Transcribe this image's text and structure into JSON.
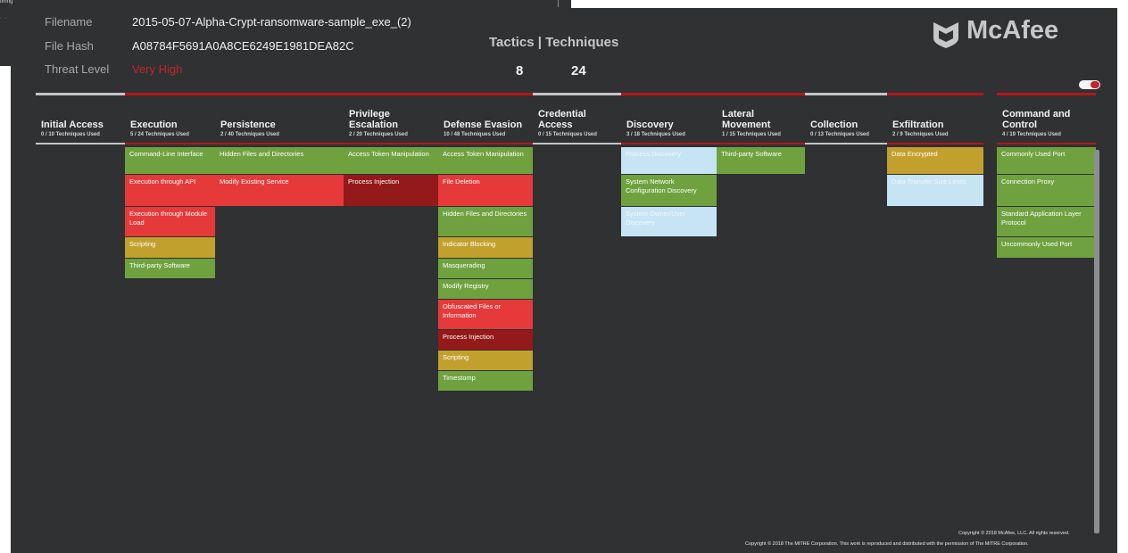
{
  "background": {
    "fragment_text": "oisoning",
    "fragment_dots": "· · ·"
  },
  "file_info": {
    "filename_label": "Filename",
    "filename_value": "2015-05-07-Alpha-Crypt-ransomware-sample_exe_(2)",
    "hash_label": "File Hash",
    "hash_value": "A08784F5691A0A8CE6249E1981DEA82C",
    "threat_label": "Threat Level",
    "threat_value": "Very High"
  },
  "summary": {
    "title": "Tactics | Techniques",
    "tactics_count": "8",
    "techniques_count": "24"
  },
  "logo": {
    "text": "McAfee",
    "icon": "mcafee-shield-icon"
  },
  "toggle": {
    "state": "on"
  },
  "colors": {
    "green": "#6fa23f",
    "red": "#e5393a",
    "dark_red": "#93191a",
    "yellow": "#c2a02d",
    "light_blue": "#c6e4f4",
    "used_bar": "#b3171b",
    "unused_bar": "#c4c5c7",
    "panel_bg": "#303133"
  },
  "tactics": [
    {
      "name": "Initial Access",
      "used": "0 / 10 Techniques Used",
      "active": false,
      "cells": []
    },
    {
      "name": "Execution",
      "used": "5 / 24 Techniques Used",
      "active": true,
      "cells": [
        {
          "label": "Command-Line Interface",
          "color": "green"
        },
        {
          "label": "Execution through API",
          "color": "red"
        },
        {
          "label": "Execution through Module Load",
          "color": "red"
        },
        {
          "label": "Scripting",
          "color": "yellow"
        },
        {
          "label": "Third-party Software",
          "color": "green"
        }
      ]
    },
    {
      "name": "Persistence",
      "used": "2 / 40 Techniques Used",
      "active": true,
      "cells": [
        {
          "label": "Hidden Files and Directories",
          "color": "green"
        },
        {
          "label": "Modify Existing Service",
          "color": "red"
        }
      ]
    },
    {
      "name": "Privilege Escalation",
      "used": "2 / 20 Techniques Used",
      "active": true,
      "cells": [
        {
          "label": "Access Token Manipulation",
          "color": "green"
        },
        {
          "label": "Process Injection",
          "color": "darkred"
        }
      ]
    },
    {
      "name": "Defense Evasion",
      "used": "10 / 48 Techniques Used",
      "active": true,
      "cells": [
        {
          "label": "Access Token Manipulation",
          "color": "green"
        },
        {
          "label": "File Deletion",
          "color": "red"
        },
        {
          "label": "Hidden Files and Directories",
          "color": "green"
        },
        {
          "label": "Indicator Blocking",
          "color": "yellow"
        },
        {
          "label": "Masquerading",
          "color": "green"
        },
        {
          "label": "Modify Registry",
          "color": "green"
        },
        {
          "label": "Obfuscated Files or Information",
          "color": "red"
        },
        {
          "label": "Process Injection",
          "color": "darkred"
        },
        {
          "label": "Scripting",
          "color": "yellow"
        },
        {
          "label": "Timestomp",
          "color": "green"
        }
      ]
    },
    {
      "name": "Credential Access",
      "used": "0 / 15 Techniques Used",
      "active": false,
      "cells": []
    },
    {
      "name": "Discovery",
      "used": "3 / 18 Techniques Used",
      "active": true,
      "cells": [
        {
          "label": "Process Discovery",
          "color": "lightblue"
        },
        {
          "label": "System Network Configuration Discovery",
          "color": "green"
        },
        {
          "label": "System Owner/User Discovery",
          "color": "lightblue"
        }
      ]
    },
    {
      "name": "Lateral Movement",
      "used": "1 / 15 Techniques Used",
      "active": true,
      "cells": [
        {
          "label": "Third-party Software",
          "color": "green"
        }
      ]
    },
    {
      "name": "Collection",
      "used": "0 / 13 Techniques Used",
      "active": false,
      "cells": []
    },
    {
      "name": "Exfiltration",
      "used": "2 / 9 Techniques Used",
      "active": true,
      "cells": [
        {
          "label": "Data Encrypted",
          "color": "yellow"
        },
        {
          "label": "Data Transfer Size Limits",
          "color": "lightblue"
        }
      ]
    },
    {
      "name": "Command and Control",
      "used": "4 / 19 Techniques Used",
      "active": true,
      "cells": [
        {
          "label": "Commonly Used Port",
          "color": "green"
        },
        {
          "label": "Connection Proxy",
          "color": "green"
        },
        {
          "label": "Standard Application Layer Protocol",
          "color": "green"
        },
        {
          "label": "Uncommonly Used Port",
          "color": "green"
        }
      ]
    }
  ],
  "footer": {
    "copyright_mcafee": "Copyright © 2018 McAfee, LLC. All rights reserved.",
    "copyright_mitre": "Copyright © 2018 The MITRE Corporation. This work is reproduced and distributed with the permission of The MITRE Corporation."
  }
}
